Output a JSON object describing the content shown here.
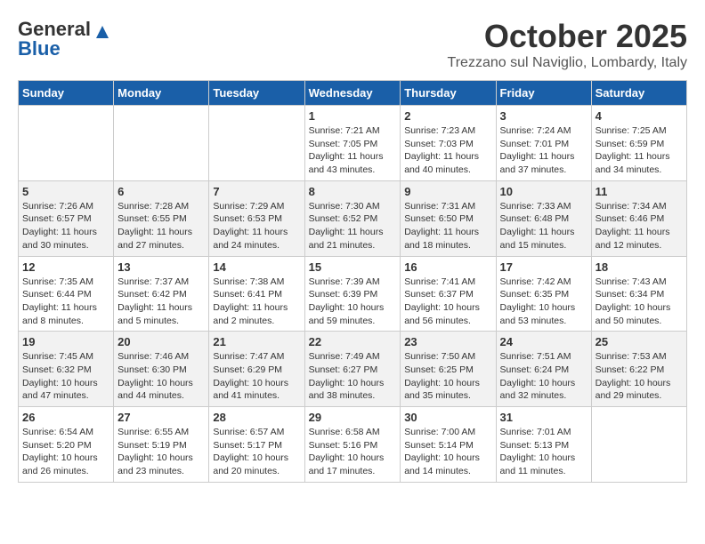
{
  "header": {
    "logo_general": "General",
    "logo_blue": "Blue",
    "month_year": "October 2025",
    "location": "Trezzano sul Naviglio, Lombardy, Italy"
  },
  "days_of_week": [
    "Sunday",
    "Monday",
    "Tuesday",
    "Wednesday",
    "Thursday",
    "Friday",
    "Saturday"
  ],
  "weeks": [
    {
      "cells": [
        {
          "day": "",
          "info": ""
        },
        {
          "day": "",
          "info": ""
        },
        {
          "day": "",
          "info": ""
        },
        {
          "day": "1",
          "info": "Sunrise: 7:21 AM\nSunset: 7:05 PM\nDaylight: 11 hours\nand 43 minutes."
        },
        {
          "day": "2",
          "info": "Sunrise: 7:23 AM\nSunset: 7:03 PM\nDaylight: 11 hours\nand 40 minutes."
        },
        {
          "day": "3",
          "info": "Sunrise: 7:24 AM\nSunset: 7:01 PM\nDaylight: 11 hours\nand 37 minutes."
        },
        {
          "day": "4",
          "info": "Sunrise: 7:25 AM\nSunset: 6:59 PM\nDaylight: 11 hours\nand 34 minutes."
        }
      ]
    },
    {
      "cells": [
        {
          "day": "5",
          "info": "Sunrise: 7:26 AM\nSunset: 6:57 PM\nDaylight: 11 hours\nand 30 minutes."
        },
        {
          "day": "6",
          "info": "Sunrise: 7:28 AM\nSunset: 6:55 PM\nDaylight: 11 hours\nand 27 minutes."
        },
        {
          "day": "7",
          "info": "Sunrise: 7:29 AM\nSunset: 6:53 PM\nDaylight: 11 hours\nand 24 minutes."
        },
        {
          "day": "8",
          "info": "Sunrise: 7:30 AM\nSunset: 6:52 PM\nDaylight: 11 hours\nand 21 minutes."
        },
        {
          "day": "9",
          "info": "Sunrise: 7:31 AM\nSunset: 6:50 PM\nDaylight: 11 hours\nand 18 minutes."
        },
        {
          "day": "10",
          "info": "Sunrise: 7:33 AM\nSunset: 6:48 PM\nDaylight: 11 hours\nand 15 minutes."
        },
        {
          "day": "11",
          "info": "Sunrise: 7:34 AM\nSunset: 6:46 PM\nDaylight: 11 hours\nand 12 minutes."
        }
      ]
    },
    {
      "cells": [
        {
          "day": "12",
          "info": "Sunrise: 7:35 AM\nSunset: 6:44 PM\nDaylight: 11 hours\nand 8 minutes."
        },
        {
          "day": "13",
          "info": "Sunrise: 7:37 AM\nSunset: 6:42 PM\nDaylight: 11 hours\nand 5 minutes."
        },
        {
          "day": "14",
          "info": "Sunrise: 7:38 AM\nSunset: 6:41 PM\nDaylight: 11 hours\nand 2 minutes."
        },
        {
          "day": "15",
          "info": "Sunrise: 7:39 AM\nSunset: 6:39 PM\nDaylight: 10 hours\nand 59 minutes."
        },
        {
          "day": "16",
          "info": "Sunrise: 7:41 AM\nSunset: 6:37 PM\nDaylight: 10 hours\nand 56 minutes."
        },
        {
          "day": "17",
          "info": "Sunrise: 7:42 AM\nSunset: 6:35 PM\nDaylight: 10 hours\nand 53 minutes."
        },
        {
          "day": "18",
          "info": "Sunrise: 7:43 AM\nSunset: 6:34 PM\nDaylight: 10 hours\nand 50 minutes."
        }
      ]
    },
    {
      "cells": [
        {
          "day": "19",
          "info": "Sunrise: 7:45 AM\nSunset: 6:32 PM\nDaylight: 10 hours\nand 47 minutes."
        },
        {
          "day": "20",
          "info": "Sunrise: 7:46 AM\nSunset: 6:30 PM\nDaylight: 10 hours\nand 44 minutes."
        },
        {
          "day": "21",
          "info": "Sunrise: 7:47 AM\nSunset: 6:29 PM\nDaylight: 10 hours\nand 41 minutes."
        },
        {
          "day": "22",
          "info": "Sunrise: 7:49 AM\nSunset: 6:27 PM\nDaylight: 10 hours\nand 38 minutes."
        },
        {
          "day": "23",
          "info": "Sunrise: 7:50 AM\nSunset: 6:25 PM\nDaylight: 10 hours\nand 35 minutes."
        },
        {
          "day": "24",
          "info": "Sunrise: 7:51 AM\nSunset: 6:24 PM\nDaylight: 10 hours\nand 32 minutes."
        },
        {
          "day": "25",
          "info": "Sunrise: 7:53 AM\nSunset: 6:22 PM\nDaylight: 10 hours\nand 29 minutes."
        }
      ]
    },
    {
      "cells": [
        {
          "day": "26",
          "info": "Sunrise: 6:54 AM\nSunset: 5:20 PM\nDaylight: 10 hours\nand 26 minutes."
        },
        {
          "day": "27",
          "info": "Sunrise: 6:55 AM\nSunset: 5:19 PM\nDaylight: 10 hours\nand 23 minutes."
        },
        {
          "day": "28",
          "info": "Sunrise: 6:57 AM\nSunset: 5:17 PM\nDaylight: 10 hours\nand 20 minutes."
        },
        {
          "day": "29",
          "info": "Sunrise: 6:58 AM\nSunset: 5:16 PM\nDaylight: 10 hours\nand 17 minutes."
        },
        {
          "day": "30",
          "info": "Sunrise: 7:00 AM\nSunset: 5:14 PM\nDaylight: 10 hours\nand 14 minutes."
        },
        {
          "day": "31",
          "info": "Sunrise: 7:01 AM\nSunset: 5:13 PM\nDaylight: 10 hours\nand 11 minutes."
        },
        {
          "day": "",
          "info": ""
        }
      ]
    }
  ]
}
